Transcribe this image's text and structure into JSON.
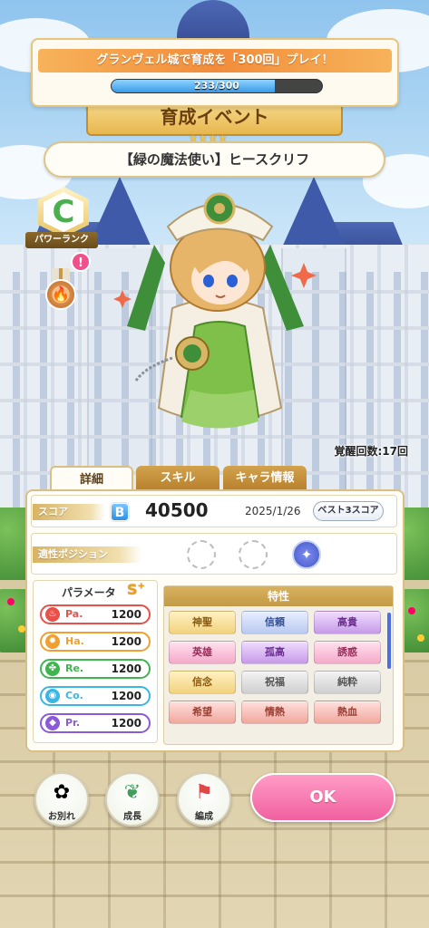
{
  "quest": {
    "title": "グランヴェル城で育成を「300回」プレイ！",
    "progress_text": "233/300",
    "progress_fraction": 0.777
  },
  "training_banner": "育成イベント",
  "character": {
    "stars": "★★★★",
    "name": "【緑の魔法使い】ヒースクリフ",
    "rank_letter": "C",
    "rank_label": "パワーランク",
    "alert": "!",
    "awaken_count": "覚醒回数:17回"
  },
  "tabs": [
    "詳細",
    "スキル",
    "キャラ情報"
  ],
  "score": {
    "label": "スコア",
    "grade": "B",
    "value": "40500",
    "date": "2025/1/26",
    "best3_button": "ベスト3スコア"
  },
  "position": {
    "label": "適性ポジション"
  },
  "params": {
    "title": "パラメータ",
    "rank": "S",
    "rank_suffix": "+",
    "items": [
      {
        "name": "Pa.",
        "value": "1200",
        "color": "#e8504a",
        "icon": "flame-icon"
      },
      {
        "name": "Ha.",
        "value": "1200",
        "color": "#f0a030",
        "icon": "sun-icon"
      },
      {
        "name": "Re.",
        "value": "1200",
        "color": "#3fb550",
        "icon": "clover-icon"
      },
      {
        "name": "Co.",
        "value": "1200",
        "color": "#3ab6e6",
        "icon": "drop-icon"
      },
      {
        "name": "Pr.",
        "value": "1200",
        "color": "#8a5ad8",
        "icon": "gem-icon"
      }
    ]
  },
  "traits": {
    "title": "特性",
    "items": [
      {
        "label": "神聖",
        "style": "gold"
      },
      {
        "label": "信頼",
        "style": "blue"
      },
      {
        "label": "高貴",
        "style": "purple"
      },
      {
        "label": "英雄",
        "style": "pink"
      },
      {
        "label": "孤高",
        "style": "purple"
      },
      {
        "label": "誘惑",
        "style": "pink"
      },
      {
        "label": "信念",
        "style": "gold"
      },
      {
        "label": "祝福",
        "style": "gray"
      },
      {
        "label": "純粋",
        "style": "gray"
      },
      {
        "label": "希望",
        "style": "red"
      },
      {
        "label": "情熱",
        "style": "red"
      },
      {
        "label": "熱血",
        "style": "red"
      }
    ]
  },
  "buttons": {
    "farewell": "お別れ",
    "growth": "成長",
    "formation": "編成",
    "ok": "OK"
  }
}
